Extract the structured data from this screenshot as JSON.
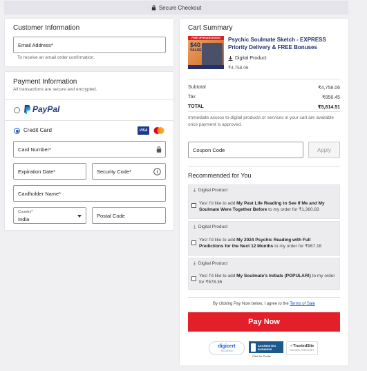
{
  "header": {
    "secure_label": "Secure Checkout"
  },
  "customer": {
    "title": "Customer Information",
    "email_label": "Email Address*",
    "email_hint": "To receive an email order confirmation."
  },
  "payment": {
    "title": "Payment Information",
    "subtitle": "All transactions are secure and encrypted.",
    "paypal_label": "PayPal",
    "credit_label": "Credit Card",
    "visa_label": "VISA",
    "card_number_label": "Card Number*",
    "expiration_label": "Expiration Date*",
    "security_label": "Security Code*",
    "cardholder_label": "Cardholder Name*",
    "country_label": "Country*",
    "country_value": "India",
    "postal_label": "Postal Code"
  },
  "cart": {
    "title": "Cart Summary",
    "product": {
      "name": "Psychic Soulmate Sketch - EXPRESS Priority Delivery & FREE Bonuses",
      "type": "Digital Product",
      "price": "₹4,758.06",
      "thumb_banner": "FREE UPGRADE BONUS",
      "thumb_value": "$40",
      "thumb_value_label": "VALUE"
    },
    "subtotal_label": "Subtotal",
    "subtotal_value": "₹4,758.06",
    "tax_label": "Tax",
    "tax_value": "₹856.45",
    "total_label": "TOTAL",
    "total_value": "₹5,614.51",
    "access_note": "Immediate access to digital products or services in your cart are available once payment is approved.",
    "coupon_label": "Coupon Code",
    "apply_label": "Apply"
  },
  "recommended": {
    "title": "Recommended for You",
    "items": [
      {
        "tag": "Digital Product",
        "pre": "Yes! I'd like to add ",
        "bold": "My Past Life Reading to See If Me and My Soulmate Were Together Before",
        "post": " to my order for ₹1,360.83"
      },
      {
        "tag": "Digital Product",
        "pre": "Yes! I'd like to add ",
        "bold": "My 2024 Psychic Reading with Full Predictions for the Next 12 Months",
        "post": " to my order for ₹967.16"
      },
      {
        "tag": "Digital Product",
        "pre": "Yes! I'd like to add ",
        "bold": "My Soulmate's Initials (POPULAR!)",
        "post": " to my order for ₹578.36"
      }
    ]
  },
  "footer": {
    "terms_pre": "By clicking Pay Now below, I agree to the ",
    "terms_link": "Terms of Sale",
    "paynow_label": "Pay Now",
    "badge_digicert": "digicert",
    "badge_digicert_sub": "SECURED",
    "badge_bbb_line1": "ACCREDITED",
    "badge_bbb_line2": "BUSINESS",
    "badge_bbb_click": "Click for Profile",
    "badge_trusted": "TrustedSite",
    "badge_trusted_sub": "SECURE CHECKOUT"
  },
  "colors": {
    "accent_red": "#e3202a",
    "paypal_dark": "#253b80",
    "paypal_light": "#179bd7",
    "link_blue": "#1a56c9"
  }
}
